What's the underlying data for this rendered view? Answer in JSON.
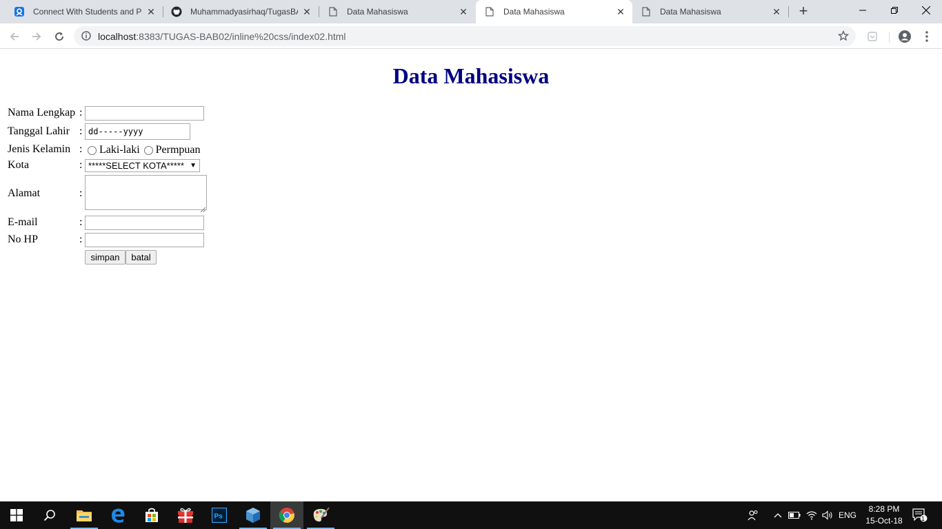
{
  "browser": {
    "tabs": [
      {
        "title": "Connect With Students and Pa",
        "favicon": "classroom-icon"
      },
      {
        "title": "Muhammadyasirhaq/TugasBA",
        "favicon": "github-icon"
      },
      {
        "title": "Data Mahasiswa",
        "favicon": "page-icon"
      },
      {
        "title": "Data Mahasiswa",
        "favicon": "page-icon"
      },
      {
        "title": "Data Mahasiswa",
        "favicon": "page-icon"
      }
    ],
    "active_tab": 3,
    "new_tab_label": "+",
    "url_host": "localhost",
    "url_rest": ":8383/TUGAS-BAB02/inline%20css/index02.html"
  },
  "page": {
    "title": "Data Mahasiswa",
    "title_color": "#000080",
    "form": {
      "nama_label": "Nama Lengkap",
      "tanggal_label": "Tanggal Lahir",
      "tanggal_placeholder": "dd-----yyyy",
      "jenis_label": "Jenis Kelamin",
      "gender_options": [
        "Laki-laki",
        "Permpuan"
      ],
      "kota_label": "Kota",
      "kota_selected": "*****SELECT KOTA*****",
      "alamat_label": "Alamat",
      "email_label": "E-mail",
      "hp_label": "No HP",
      "colon": ":",
      "simpan_label": "simpan",
      "batal_label": "batal"
    }
  },
  "taskbar": {
    "apps": [
      "start-icon",
      "search-icon",
      "file-explorer-icon",
      "edge-icon",
      "store-icon",
      "gift-icon",
      "photoshop-icon",
      "virtualbox-icon",
      "chrome-icon",
      "paint-icon"
    ],
    "language": "ENG",
    "time": "8:28 PM",
    "date": "15-Oct-18",
    "notification_count": "1"
  }
}
